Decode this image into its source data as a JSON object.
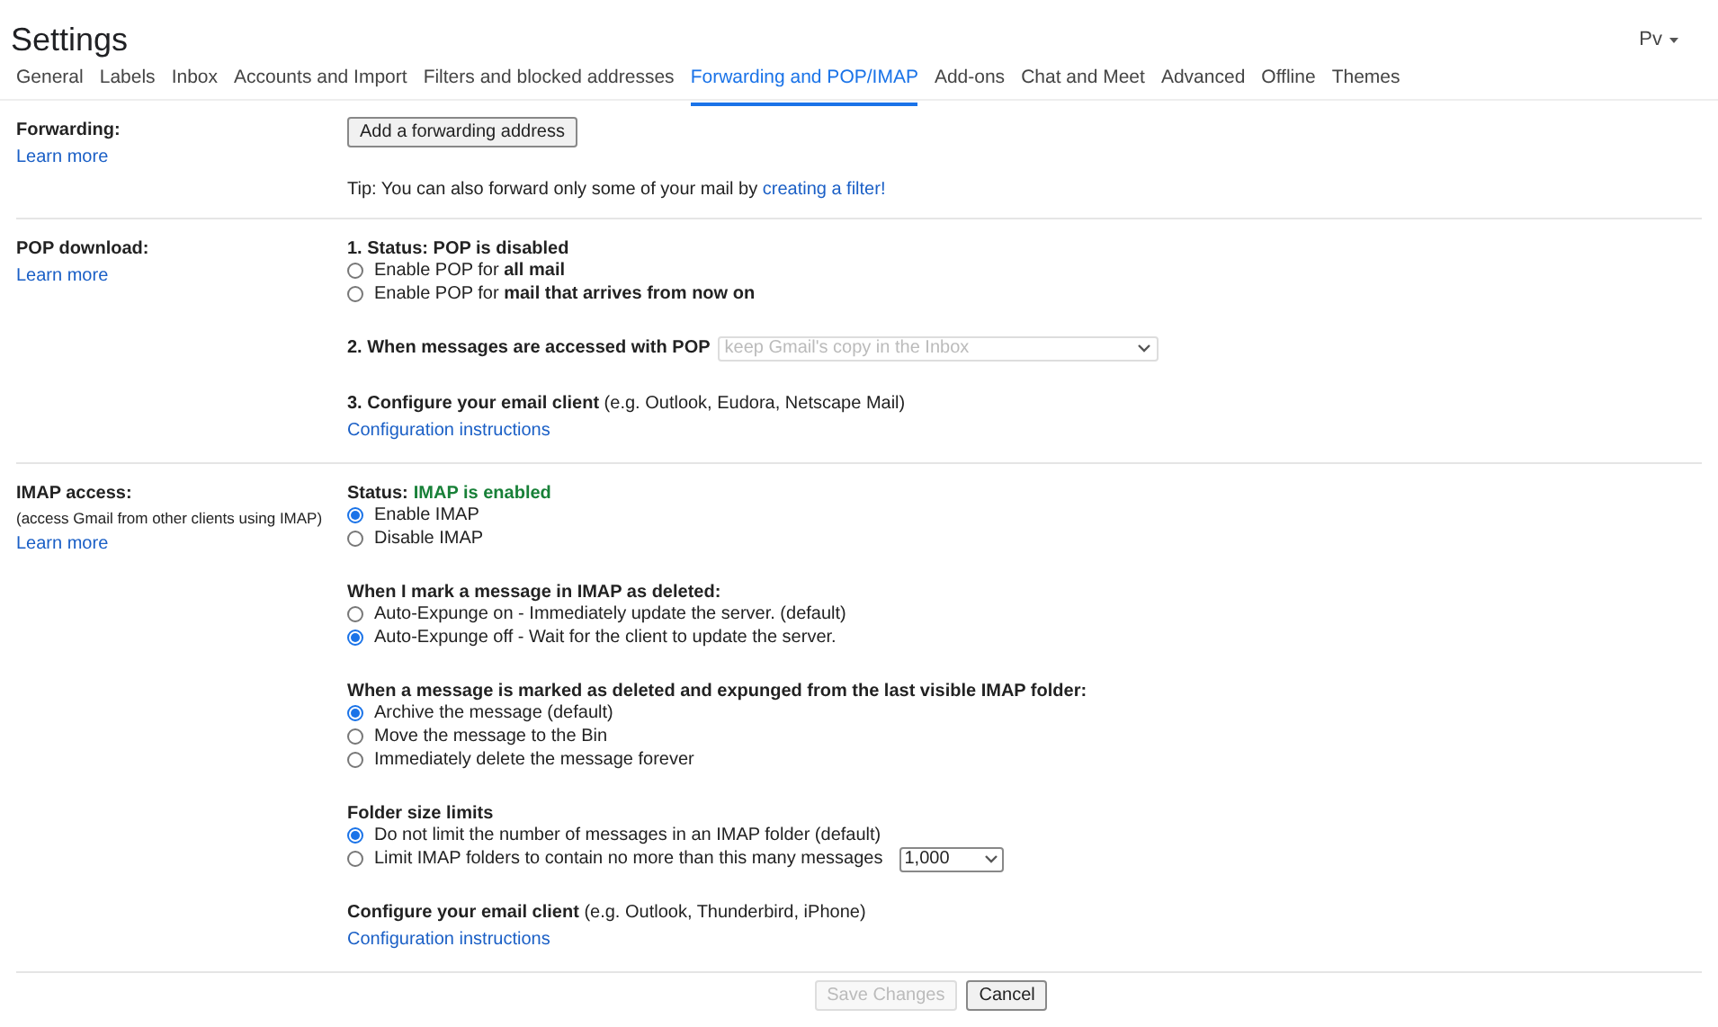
{
  "title": "Settings",
  "account": {
    "initials": "Pv"
  },
  "tabs": [
    {
      "label": "General",
      "selected": false
    },
    {
      "label": "Labels",
      "selected": false
    },
    {
      "label": "Inbox",
      "selected": false
    },
    {
      "label": "Accounts and Import",
      "selected": false
    },
    {
      "label": "Filters and blocked addresses",
      "selected": false
    },
    {
      "label": "Forwarding and POP/IMAP",
      "selected": true
    },
    {
      "label": "Add-ons",
      "selected": false
    },
    {
      "label": "Chat and Meet",
      "selected": false
    },
    {
      "label": "Advanced",
      "selected": false
    },
    {
      "label": "Offline",
      "selected": false
    },
    {
      "label": "Themes",
      "selected": false
    }
  ],
  "sections": [
    {
      "label": "Forwarding:",
      "link": "Learn more",
      "blocks": [
        {
          "kind": "button",
          "label": "Add a forwarding address"
        },
        {
          "kind": "tip",
          "text": "Tip: You can also forward only some of your mail by",
          "link": "creating a filter!"
        }
      ]
    },
    {
      "label": "POP download:",
      "link": "Learn more",
      "blocks": [
        {
          "kind": "radios",
          "heading": "1. Status: POP is disabled",
          "options": [
            {
              "label": "Enable POP for **all mail**",
              "selected": false
            },
            {
              "label": "Enable POP for **mail that arrives from now on**",
              "selected": false
            }
          ]
        },
        {
          "kind": "select_row",
          "label": "2. When messages are accessed with POP",
          "value": "keep Gmail's copy in the Inbox",
          "disabled": true
        },
        {
          "kind": "configure",
          "text": "**3. Configure your email client** (e.g. Outlook, Eudora, Netscape Mail)",
          "link": "Configuration instructions"
        }
      ]
    },
    {
      "label": "IMAP access:",
      "note": "(access Gmail from other clients using IMAP)",
      "link": "Learn more",
      "blocks": [
        {
          "kind": "status",
          "label": "Status:",
          "value": "IMAP is enabled",
          "color": "#188038",
          "options": [
            {
              "label": "Enable IMAP",
              "selected": true
            },
            {
              "label": "Disable IMAP",
              "selected": false
            }
          ]
        },
        {
          "kind": "radios",
          "heading": "When I mark a message in IMAP as deleted:",
          "options": [
            {
              "label": "Auto-Expunge on - Immediately update the server. (default)",
              "selected": false
            },
            {
              "label": "Auto-Expunge off - Wait for the client to update the server.",
              "selected": true
            }
          ]
        },
        {
          "kind": "radios",
          "heading": "When a message is marked as deleted and expunged from the last visible IMAP folder:",
          "options": [
            {
              "label": "Archive the message (default)",
              "selected": true
            },
            {
              "label": "Move the message to the Bin",
              "selected": false
            },
            {
              "label": "Immediately delete the message forever",
              "selected": false
            }
          ]
        },
        {
          "kind": "radios",
          "heading": "Folder size limits",
          "options": [
            {
              "label": "Do not limit the number of messages in an IMAP folder (default)",
              "selected": true
            },
            {
              "label": "Limit IMAP folders to contain no more than this many messages",
              "selected": false,
              "select": "1,000"
            }
          ]
        },
        {
          "kind": "configure",
          "text": "**Configure your email client** (e.g. Outlook, Thunderbird, iPhone)",
          "link": "Configuration instructions"
        }
      ]
    }
  ],
  "footer": [
    {
      "label": "Save Changes",
      "disabled": true
    },
    {
      "label": "Cancel",
      "disabled": false
    }
  ]
}
